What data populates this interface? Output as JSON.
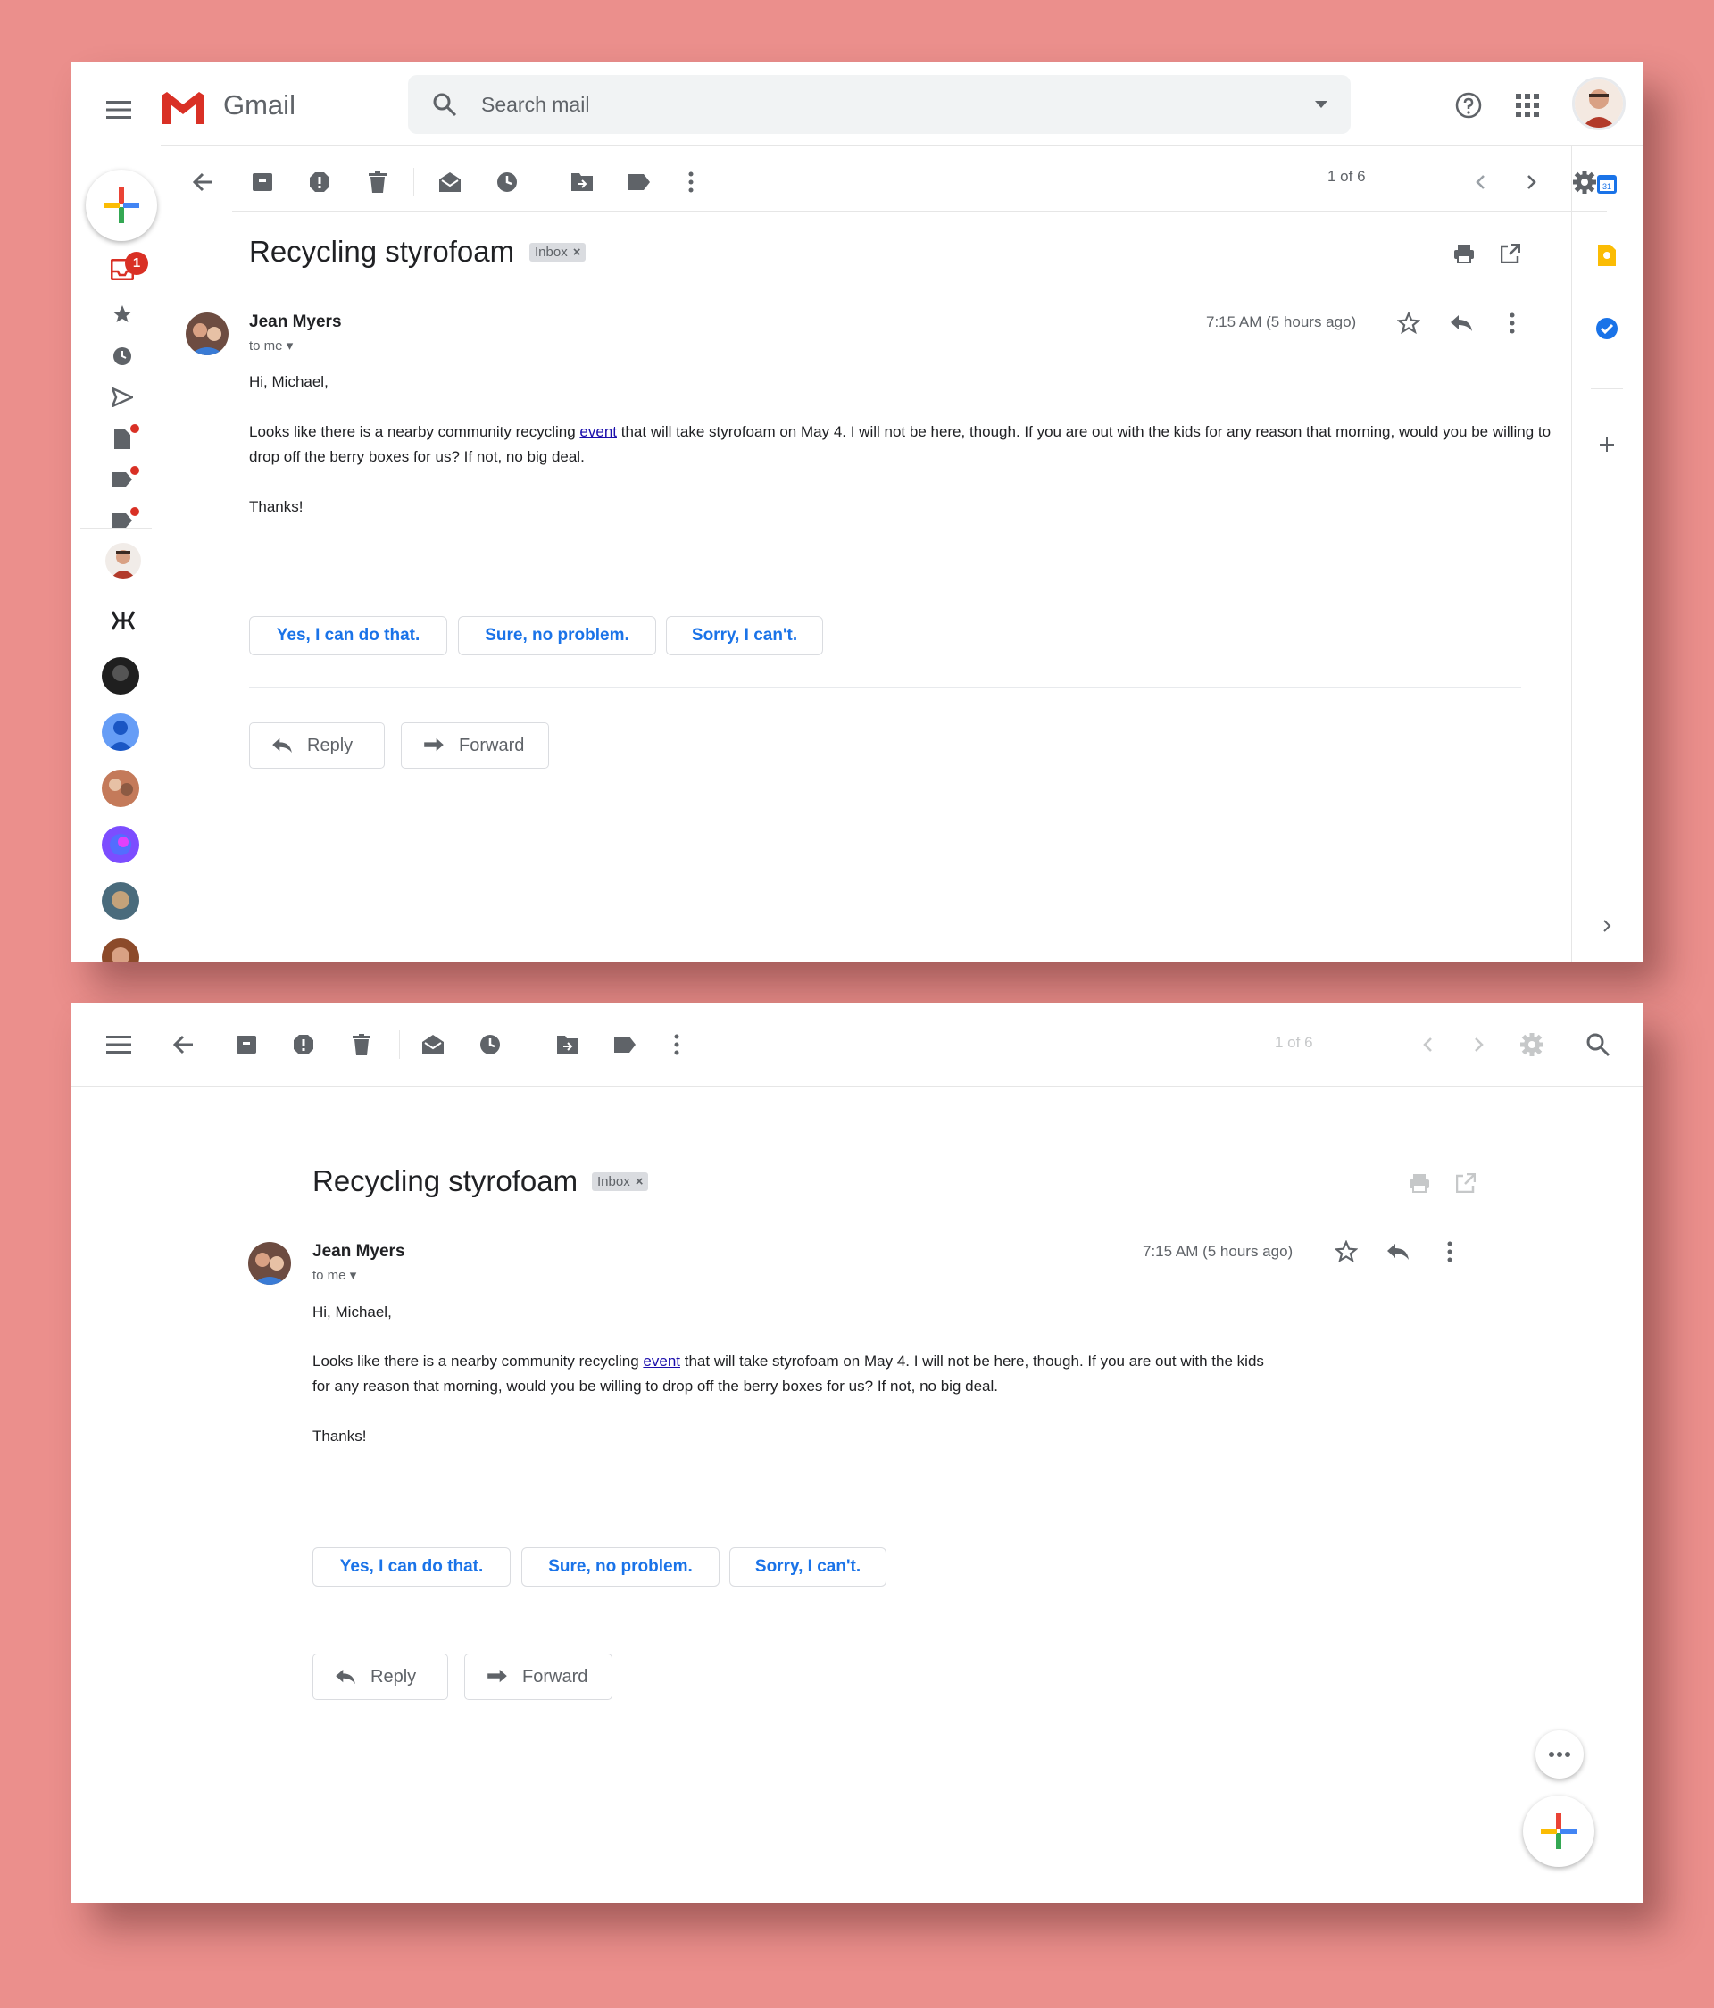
{
  "app": {
    "name": "Gmail"
  },
  "search": {
    "placeholder": "Search mail"
  },
  "email": {
    "subject": "Recycling styrofoam",
    "label": "Inbox",
    "label_remove": "×",
    "sender": "Jean Myers",
    "to": "to me",
    "time": "7:15 AM (5 hours ago)",
    "greeting": "Hi, Michael,",
    "body_before_link": "Looks like there is a nearby community recycling",
    "link_text": "event",
    "body_after_link": "that will take styrofoam on May 4. I will not be here, though. If you are out with the kids for any reason that morning, would you be willing to drop off the berry boxes for us? If not, no big deal.",
    "signoff": "Thanks!"
  },
  "smart_replies": [
    "Yes, I can do that.",
    "Sure, no problem.",
    "Sorry, I can't."
  ],
  "actions": {
    "reply": "Reply",
    "forward": "Forward"
  },
  "pagination": {
    "panel1": "1 of 6",
    "panel2": "1 of 6"
  },
  "badges": {
    "inbox_count": "1"
  },
  "icons": {
    "toolbar": [
      "back-arrow-icon",
      "archive-icon",
      "report-spam-icon",
      "delete-icon",
      "mark-unread-icon",
      "snooze-icon",
      "move-to-icon",
      "label-icon",
      "more-vert-icon"
    ],
    "header": [
      "menu-icon",
      "gmail-logo",
      "search-icon",
      "dropdown-icon",
      "help-icon",
      "apps-grid-icon",
      "account-avatar"
    ],
    "sidebar": [
      "compose-plus-icon",
      "inbox-icon",
      "star-icon",
      "clock-icon",
      "send-icon",
      "draft-icon",
      "label-icon"
    ],
    "side_panel": [
      "calendar-icon",
      "keep-icon",
      "tasks-icon",
      "add-icon",
      "chevron-right-icon"
    ]
  },
  "colors": {
    "background": "#eb8f8c",
    "gmail_red": "#d93025",
    "link_blue": "#1a73e8",
    "text_gray": "#5f6368"
  }
}
